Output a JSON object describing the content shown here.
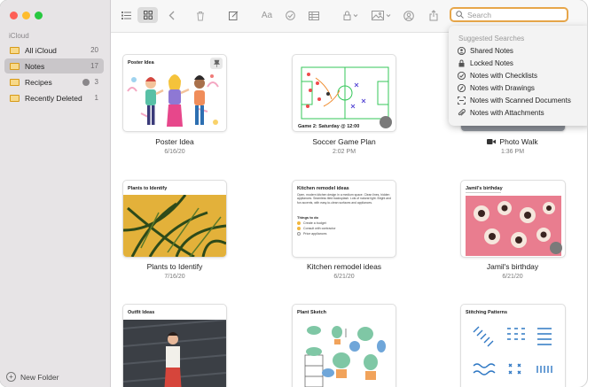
{
  "sidebar": {
    "section": "iCloud",
    "items": [
      {
        "label": "All iCloud",
        "count": "20"
      },
      {
        "label": "Notes",
        "count": "17"
      },
      {
        "label": "Recipes",
        "count": "3"
      },
      {
        "label": "Recently Deleted",
        "count": "1"
      }
    ],
    "new_folder": "New Folder"
  },
  "toolbar": {
    "search_placeholder": "Search",
    "format_label": "Aa"
  },
  "search_suggestions": {
    "header": "Suggested Searches",
    "items": [
      {
        "label": "Shared Notes",
        "icon": "person-circle-icon"
      },
      {
        "label": "Locked Notes",
        "icon": "lock-icon"
      },
      {
        "label": "Notes with Checklists",
        "icon": "checkmark-circle-icon"
      },
      {
        "label": "Notes with Drawings",
        "icon": "pencil-circle-icon"
      },
      {
        "label": "Notes with Scanned Documents",
        "icon": "scan-icon"
      },
      {
        "label": "Notes with Attachments",
        "icon": "paperclip-icon"
      }
    ]
  },
  "notes": [
    {
      "thumb_title": "Poster Idea",
      "name": "Poster Idea",
      "date": "6/16/20"
    },
    {
      "thumb_title": "Game 2: Saturday @ 12:00",
      "name": "Soccer Game Plan",
      "date": "2:02 PM"
    },
    {
      "thumb_title": "",
      "name": "Photo Walk",
      "date": "1:36 PM"
    },
    {
      "thumb_title": "Plants to Identify",
      "name": "Plants to Identify",
      "date": "7/16/20"
    },
    {
      "thumb_title": "Kitchen remodel ideas",
      "name": "Kitchen remodel ideas",
      "date": "6/21/20"
    },
    {
      "thumb_title": "Jamil's birthday",
      "name": "Jamil's birthday",
      "date": "6/21/20"
    },
    {
      "thumb_title": "Outfit Ideas",
      "name": "",
      "date": ""
    },
    {
      "thumb_title": "Plant Sketch",
      "name": "",
      "date": ""
    },
    {
      "thumb_title": "Stitching Patterns",
      "name": "",
      "date": ""
    }
  ],
  "kitchen": {
    "body": "Open, modern kitchen design in a medium space. Clean lines, hidden appliances. Seamless tiled backsplash. Lots of natural light. Bright and fun accents, with easy-to-clean surfaces and appliances.",
    "todo_title": "Things to do",
    "todos": [
      "Create a budget",
      "Consult with contractor",
      "Price appliances"
    ]
  },
  "colors": {
    "accent": "#e7a64a",
    "folder": "#d79a17"
  }
}
